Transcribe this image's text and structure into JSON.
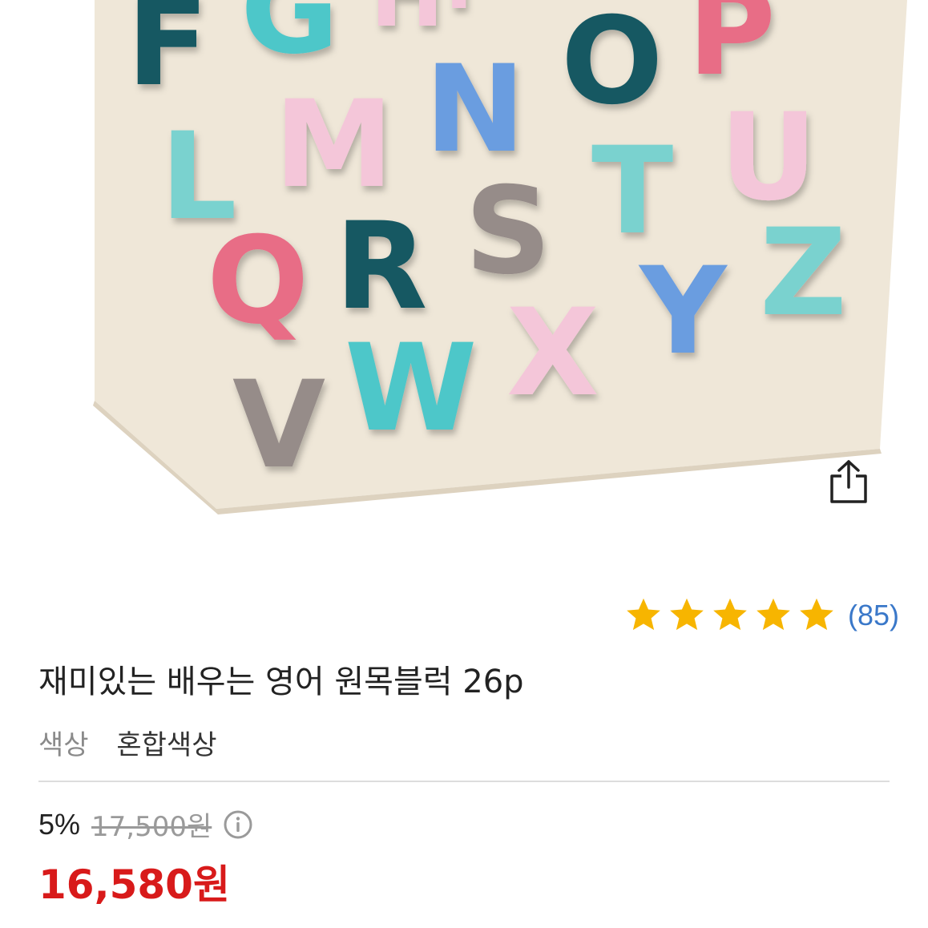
{
  "product": {
    "image_alt": "alphabet puzzle board",
    "letters": [
      "F",
      "G",
      "H",
      "I",
      "O",
      "P",
      "L",
      "M",
      "N",
      "T",
      "U",
      "Q",
      "R",
      "S",
      "Z",
      "Y",
      "V",
      "W",
      "X"
    ],
    "title": "재미있는 배우는 영어 원목블럭 26p"
  },
  "rating": {
    "stars": 5,
    "star_color": "#f7b500",
    "count_text": "(85)"
  },
  "option": {
    "label": "색상",
    "value": "혼합색상"
  },
  "price": {
    "discount": "5%",
    "original": "17,500원",
    "sale": "16,580원",
    "sale_color": "#d81a1a"
  },
  "icons": {
    "share": "share-icon",
    "info": "info-icon",
    "star": "star-icon"
  }
}
